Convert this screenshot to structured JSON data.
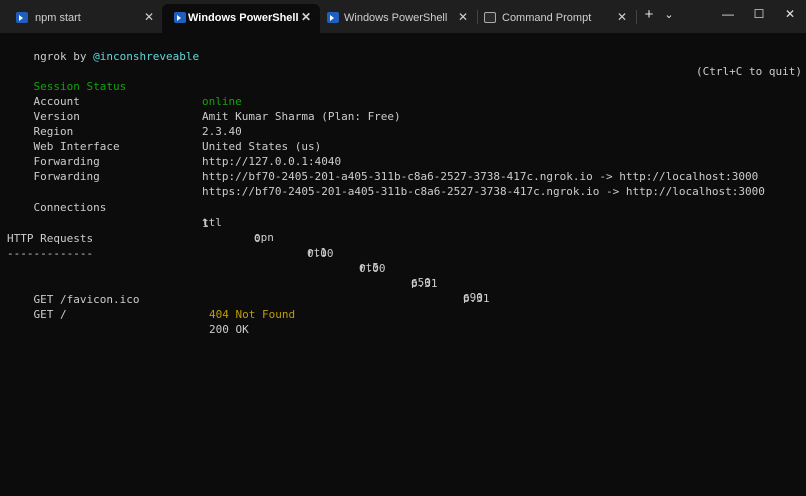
{
  "tabs": [
    {
      "label": "npm start",
      "icon": "powershell-icon",
      "active": false
    },
    {
      "label": "Windows PowerShell",
      "icon": "powershell-icon",
      "active": true
    },
    {
      "label": "Windows PowerShell",
      "icon": "powershell-icon",
      "active": false
    },
    {
      "label": "Command Prompt",
      "icon": "command-prompt-icon",
      "active": false
    }
  ],
  "titlebar": {
    "close_glyph": "✕",
    "new_tab_glyph": "+",
    "dropdown_glyph": "⌄",
    "minimize_glyph": "—",
    "maximize_glyph": "☐",
    "window_close_glyph": "✕"
  },
  "terminal": {
    "header_left_prefix": "ngrok by ",
    "header_left_handle": "@inconshreveable",
    "header_right": "(Ctrl+C to quit)",
    "fields": [
      {
        "label": "Session Status",
        "value": "online"
      },
      {
        "label": "Account",
        "value": "Amit Kumar Sharma (Plan: Free)"
      },
      {
        "label": "Version",
        "value": "2.3.40"
      },
      {
        "label": "Region",
        "value": "United States (us)"
      },
      {
        "label": "Web Interface",
        "value": "http://127.0.0.1:4040"
      },
      {
        "label": "Forwarding",
        "value": "http://bf70-2405-201-a405-311b-c8a6-2527-3738-417c.ngrok.io -> http://localhost:3000"
      },
      {
        "label": "Forwarding",
        "value": "https://bf70-2405-201-a405-311b-c8a6-2527-3738-417c.ngrok.io -> http://localhost:3000"
      }
    ],
    "connections_label": "Connections",
    "connections_headers": [
      "ttl",
      "opn",
      "rt1",
      "rt5",
      "p50",
      "p90"
    ],
    "connections_values": [
      "1",
      "0",
      "0.00",
      "0.00",
      "6.31",
      "6.31"
    ],
    "http_requests_label": "HTTP Requests",
    "http_requests_rule": "-------------",
    "requests": [
      {
        "request": "GET /favicon.ico",
        "status": "404 Not Found"
      },
      {
        "request": "GET /",
        "status": "200 OK"
      }
    ]
  },
  "colors": {
    "background": "#0c0c0c",
    "titlebar": "#1f1f1f",
    "text": "#cccccc",
    "cyan": "#61d6d6",
    "green": "#13a10e",
    "yellow": "#c19c00"
  }
}
